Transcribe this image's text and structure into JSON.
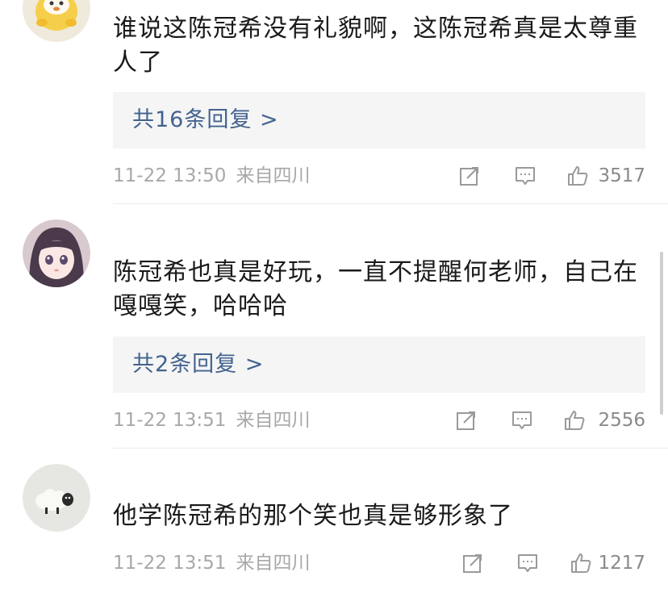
{
  "comments": [
    {
      "username": "",
      "text": "谁说这陈冠希没有礼貌啊，这陈冠希真是太尊重人了",
      "reply_label": "共16条回复 >",
      "time": "11-22 13:50",
      "location": "来自四川",
      "likes": "3517",
      "avatar_icon": "duck-avatar-icon"
    },
    {
      "username": "",
      "text": "陈冠希也真是好玩，一直不提醒何老师，自己在嘎嘎笑，哈哈哈",
      "reply_label": "共2条回复 >",
      "time": "11-22 13:51",
      "location": "来自四川",
      "likes": "2556",
      "avatar_icon": "anime-girl-avatar-icon"
    },
    {
      "username": "",
      "text": "他学陈冠希的那个笑也真是够形象了",
      "time": "11-22 13:51",
      "location": "来自四川",
      "likes": "1217",
      "avatar_icon": "sheep-avatar-icon"
    }
  ],
  "icons": {
    "share": "share-icon",
    "comment": "comment-icon",
    "like": "thumbs-up-icon"
  },
  "colors": {
    "link": "#43638f",
    "meta": "#a8a8a8",
    "text": "#1a1a1a",
    "reply_bg": "#f5f5f5"
  }
}
